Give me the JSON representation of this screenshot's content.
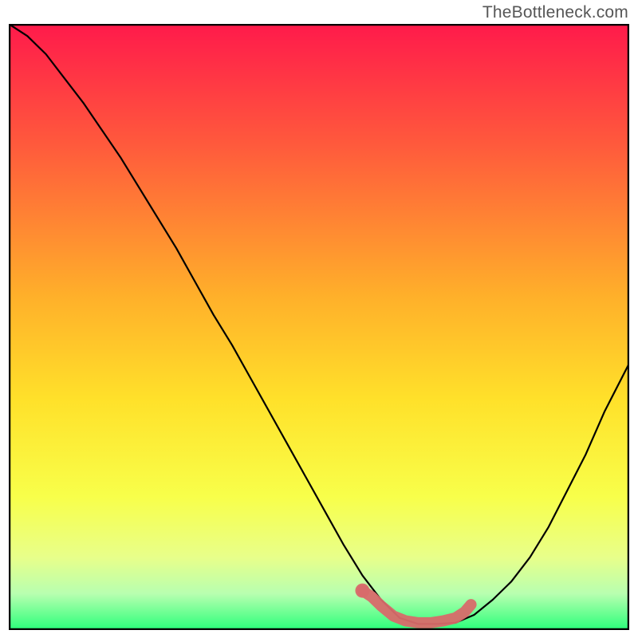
{
  "attribution": "TheBottleneck.com",
  "chart_data": {
    "type": "line",
    "title": "",
    "xlabel": "",
    "ylabel": "",
    "xlim": [
      0,
      100
    ],
    "ylim": [
      0,
      100
    ],
    "x": [
      0,
      3,
      6,
      9,
      12,
      15,
      18,
      21,
      24,
      27,
      30,
      33,
      36,
      39,
      42,
      45,
      48,
      51,
      54,
      57,
      60,
      63,
      66,
      69,
      72,
      75,
      78,
      81,
      84,
      87,
      90,
      93,
      96,
      100
    ],
    "values": [
      100,
      98,
      95,
      91,
      87,
      82.5,
      78,
      73,
      68,
      63,
      57.5,
      52,
      47,
      41.5,
      36,
      30.5,
      25,
      19.5,
      14,
      9,
      5,
      2,
      1,
      1,
      1.2,
      2.5,
      5,
      8,
      12,
      17,
      23,
      29,
      36,
      44
    ],
    "highlight": {
      "x": [
        57,
        58.5,
        60,
        62,
        64,
        66,
        68,
        70,
        72,
        73.5,
        74.5
      ],
      "values": [
        6.5,
        5.5,
        4,
        2.3,
        1.5,
        1.2,
        1.2,
        1.5,
        2,
        3,
        4.2
      ],
      "point": {
        "x": 57,
        "y": 6.5
      }
    },
    "gradient_stops": [
      {
        "offset": 0.0,
        "color": "#ff1a4b"
      },
      {
        "offset": 0.2,
        "color": "#ff5a3c"
      },
      {
        "offset": 0.45,
        "color": "#ffb02a"
      },
      {
        "offset": 0.62,
        "color": "#ffe12a"
      },
      {
        "offset": 0.78,
        "color": "#f8ff4a"
      },
      {
        "offset": 0.88,
        "color": "#e8ff8a"
      },
      {
        "offset": 0.94,
        "color": "#b8ffb0"
      },
      {
        "offset": 1.0,
        "color": "#2aff7a"
      }
    ]
  },
  "colors": {
    "curve": "#000000",
    "highlight": "#d86a6a",
    "border": "#000000"
  }
}
